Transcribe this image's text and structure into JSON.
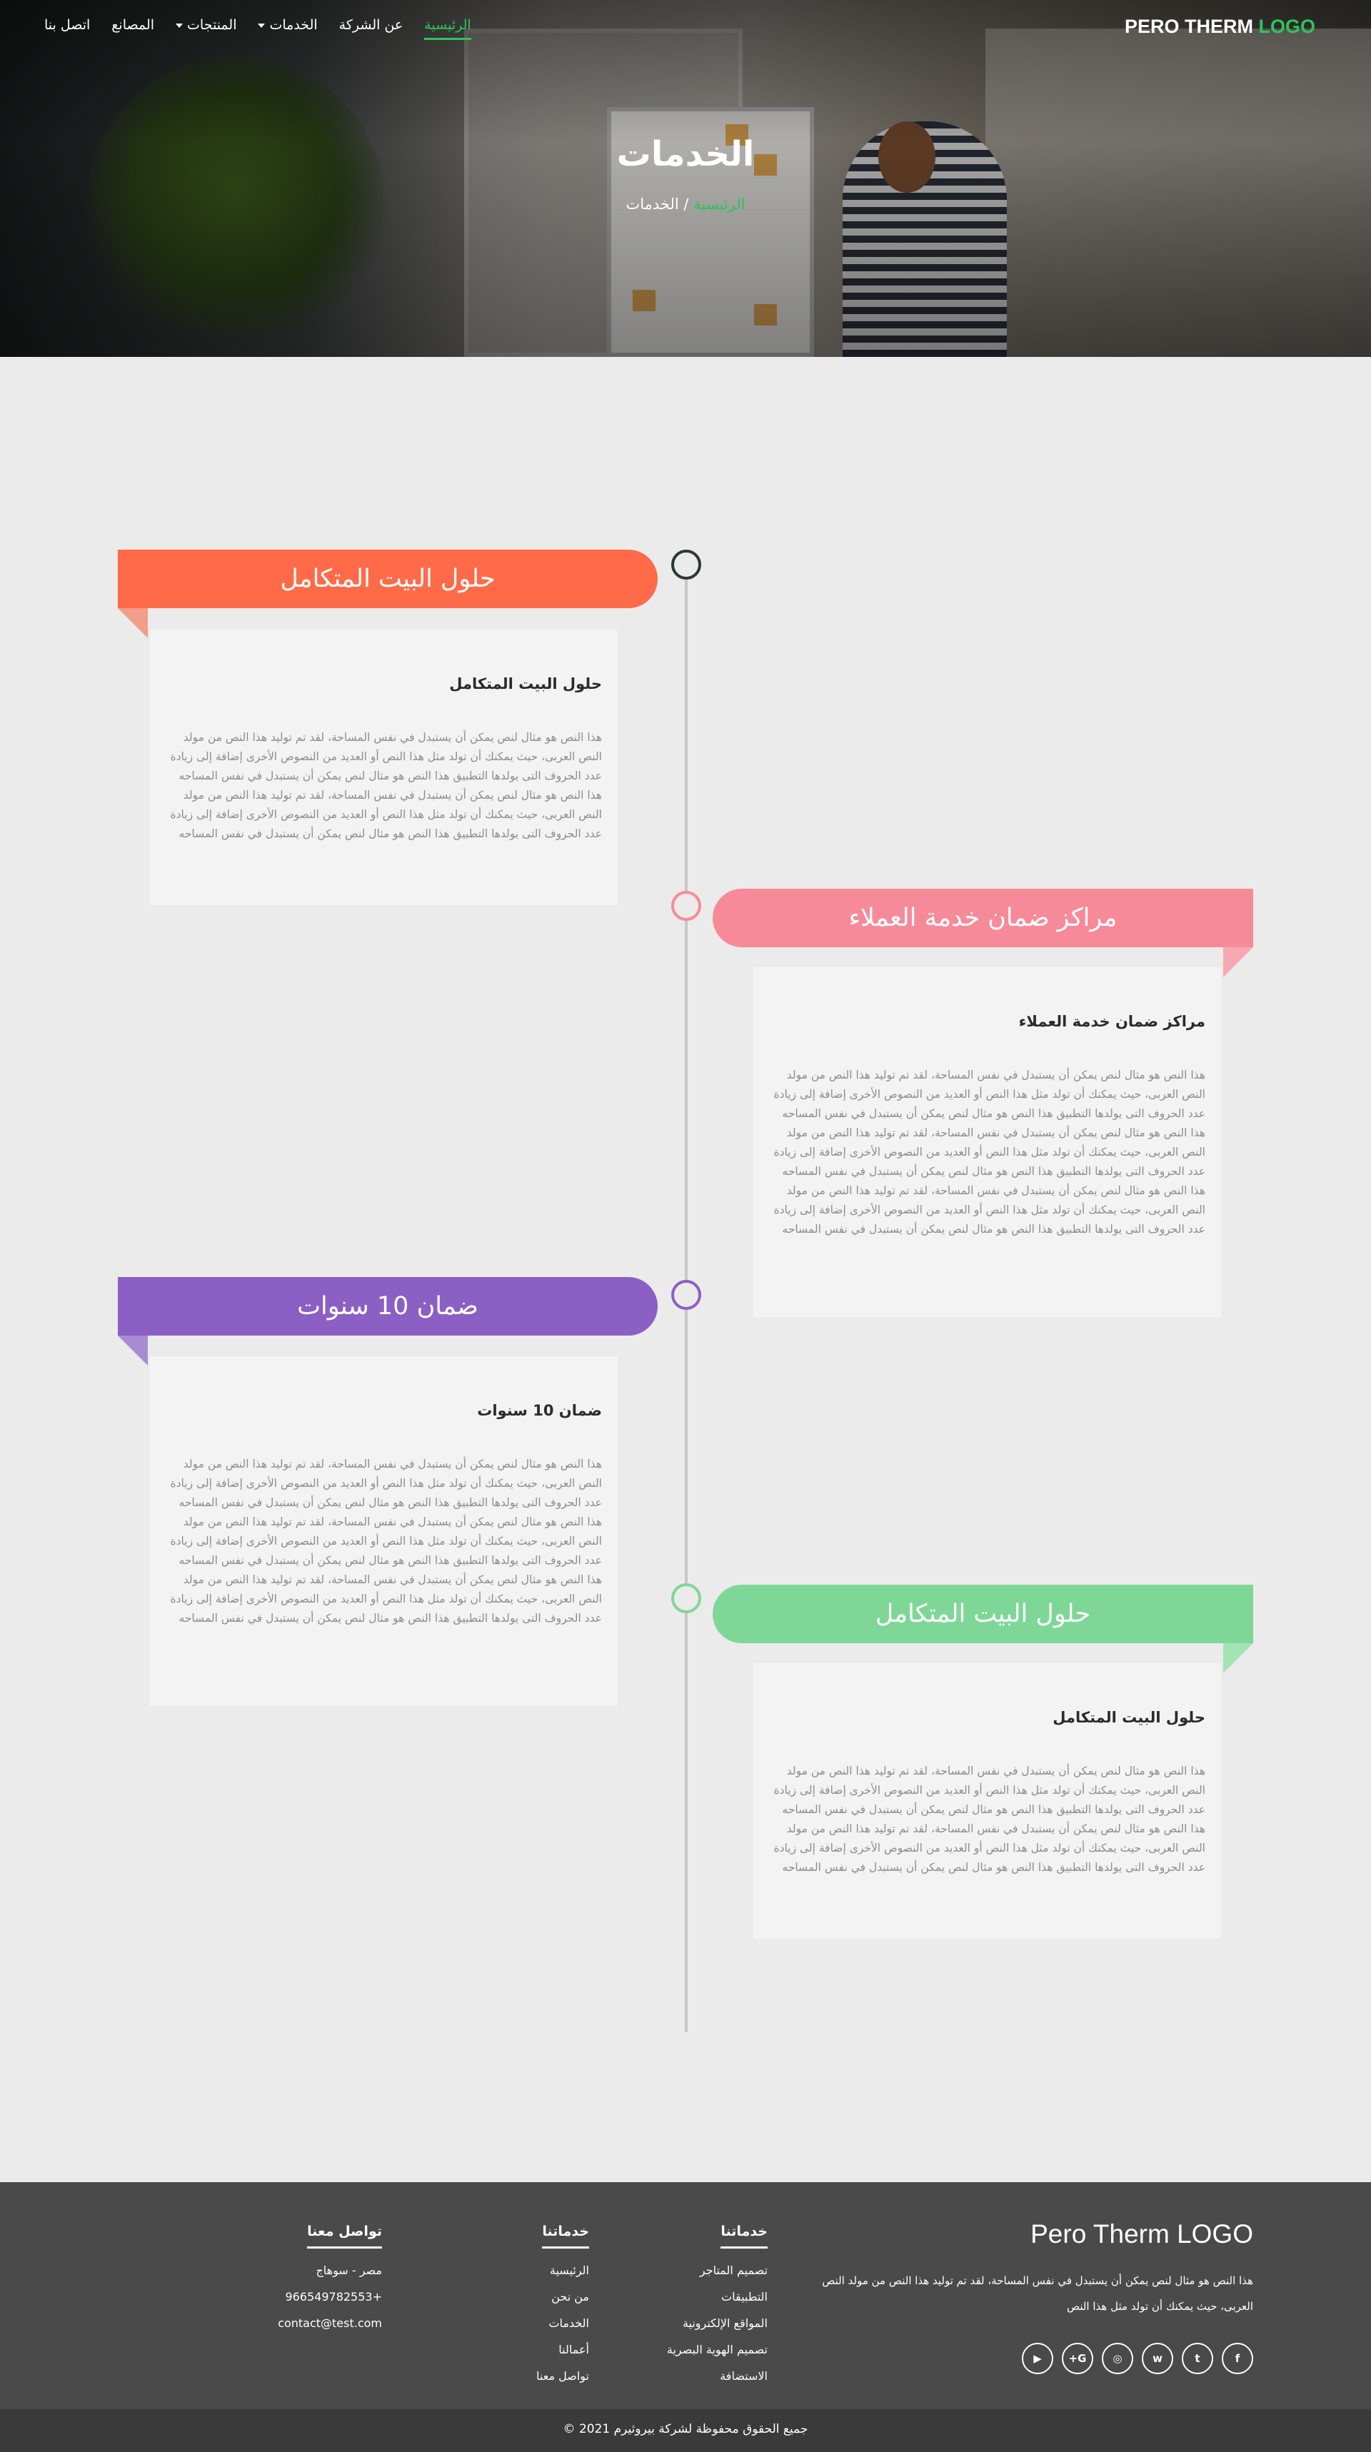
{
  "nav": {
    "items": [
      {
        "label": "الرئيسية",
        "active": true
      },
      {
        "label": "عن الشركة",
        "active": false
      },
      {
        "label": "الخدمات",
        "dropdown": true
      },
      {
        "label": "المنتجات",
        "dropdown": true
      },
      {
        "label": "المصانع",
        "active": false
      },
      {
        "label": "اتصل بنا",
        "active": false
      }
    ],
    "brand": {
      "text": "PERO THERM",
      "logo": "LOGO"
    }
  },
  "hero": {
    "title": "الخدمات",
    "breadcrumb": {
      "home": "الرئيسية",
      "separator": "/",
      "current": "الخدمات"
    }
  },
  "timeline": [
    {
      "heading": "حلول البيت المتكامل",
      "card_title": "حلول البيت المتكامل",
      "card_text": "هذا النص هو مثال لنص يمكن أن يستبدل في نفس المساحة، لقد تم توليد هذا النص من مولد النص العربى، حيث يمكنك أن تولد مثل هذا النص أو العديد من النصوص الأخرى إضافة إلى زيادة عدد الحروف التى يولدها التطبيق هذا النص هو مثال لنص يمكن أن يستبدل في نفس المساحه هذا النص هو مثال لنص يمكن أن يستبدل في نفس المساحة، لقد تم توليد هذا النص من مولد النص العربى، حيث يمكنك أن تولد مثل هذا النص أو العديد من النصوص الأخرى إضافة إلى زيادة عدد الحروف التى يولدها التطبيق هذا النص هو مثال لنص يمكن أن يستبدل في نفس المساحه",
      "color": "#ff6a48",
      "fold_color": "#f19e8a"
    },
    {
      "heading": "مراكز ضمان خدمة العملاء",
      "card_title": "مراكز ضمان خدمة العملاء",
      "card_text": "هذا النص هو مثال لنص يمكن أن يستبدل في نفس المساحة، لقد تم توليد هذا النص من مولد النص العربى، حيث يمكنك أن تولد مثل هذا النص أو العديد من النصوص الأخرى إضافة إلى زيادة عدد الحروف التى يولدها التطبيق هذا النص هو مثال لنص يمكن أن يستبدل في نفس المساحه   هذا النص هو مثال لنص يمكن أن يستبدل في نفس المساحة، لقد تم توليد هذا النص من مولد النص العربى، حيث يمكنك أن تولد مثل هذا النص أو العديد من النصوص الأخرى إضافة إلى زيادة عدد الحروف التى يولدها التطبيق هذا النص هو مثال لنص يمكن أن يستبدل في نفس المساحه   هذا النص هو مثال لنص يمكن أن يستبدل في نفس المساحة، لقد تم توليد هذا النص من مولد النص العربى، حيث يمكنك أن تولد مثل هذا النص أو العديد من النصوص الأخرى إضافة إلى زيادة عدد الحروف التى يولدها التطبيق هذا النص هو مثال لنص يمكن أن يستبدل في نفس المساحه",
      "color": "#f78a99",
      "fold_color": "#f6a9b3"
    },
    {
      "heading": "ضمان 10 سنوات",
      "card_title": "ضمان 10 سنوات",
      "card_text": "هذا النص هو مثال لنص يمكن أن يستبدل في نفس المساحة، لقد تم توليد هذا النص من مولد النص العربى، حيث يمكنك أن تولد مثل هذا النص أو العديد من النصوص الأخرى إضافة إلى زيادة عدد الحروف التى يولدها التطبيق هذا النص هو مثال لنص يمكن أن يستبدل في نفس المساحه   هذا النص هو مثال لنص يمكن أن يستبدل في نفس المساحة، لقد تم توليد هذا النص من مولد النص العربى، حيث يمكنك أن تولد مثل هذا النص أو العديد من النصوص الأخرى إضافة إلى زيادة عدد الحروف التى يولدها التطبيق هذا النص هو مثال لنص يمكن أن يستبدل في نفس المساحه   هذا النص هو مثال لنص يمكن أن يستبدل في نفس المساحة، لقد تم توليد هذا النص من مولد النص العربى، حيث يمكنك أن تولد مثل هذا النص أو العديد من النصوص الأخرى إضافة إلى زيادة عدد الحروف التى يولدها التطبيق هذا النص هو مثال لنص يمكن أن يستبدل في نفس المساحه",
      "color": "#8c5fc4",
      "fold_color": "#a98bd3"
    },
    {
      "heading": "حلول البيت المتكامل",
      "card_title": "حلول البيت المتكامل",
      "card_text": "هذا النص هو مثال لنص يمكن أن يستبدل في نفس المساحة، لقد تم توليد هذا النص من مولد النص العربى، حيث يمكنك أن تولد مثل هذا النص أو العديد من النصوص الأخرى إضافة إلى زيادة عدد الحروف التى يولدها التطبيق هذا النص هو مثال لنص يمكن أن يستبدل في نفس المساحه هذا النص هو مثال لنص يمكن أن يستبدل في نفس المساحة، لقد تم توليد هذا النص من مولد النص العربى، حيث يمكنك أن تولد مثل هذا النص أو العديد من النصوص الأخرى إضافة إلى زيادة عدد الحروف التى يولدها التطبيق هذا النص هو مثال لنص يمكن أن يستبدل في نفس المساحه",
      "color": "#7fd797",
      "fold_color": "#a3e3b4"
    }
  ],
  "footer": {
    "brand": "Pero Therm LOGO",
    "description": "هذا النص هو مثال لنص يمكن أن يستبدل في نفس المساحة، لقد تم توليد هذا النص من مولد النص العربى، حيث يمكنك أن تولد مثل هذا النص",
    "socials": [
      {
        "icon": "facebook-icon",
        "glyph": "f"
      },
      {
        "icon": "twitter-icon",
        "glyph": "t"
      },
      {
        "icon": "whatsapp-icon",
        "glyph": "w"
      },
      {
        "icon": "instagram-icon",
        "glyph": "◎"
      },
      {
        "icon": "google-plus-icon",
        "glyph": "G+"
      },
      {
        "icon": "youtube-icon",
        "glyph": "▶"
      }
    ],
    "col_services": {
      "title": "خدماتنا",
      "items": [
        "تصميم المتاجر",
        "التطبيقات",
        "المواقع الإلكترونية",
        "تصميم الهوية البصرية",
        "الاستضافة"
      ]
    },
    "col_links": {
      "title": "خدماتنا",
      "items": [
        "الرئيسية",
        "من نحن",
        "الخدمات",
        "أعمالنا",
        "تواصل معنا"
      ]
    },
    "col_contact": {
      "title": "تواصل معنا",
      "items": [
        "مصر - سوهاج",
        "+966549782553",
        "contact@test.com"
      ]
    },
    "copyright": "جميع الحقوق محفوظة لشركة بيروثيرم 2021 ©"
  }
}
